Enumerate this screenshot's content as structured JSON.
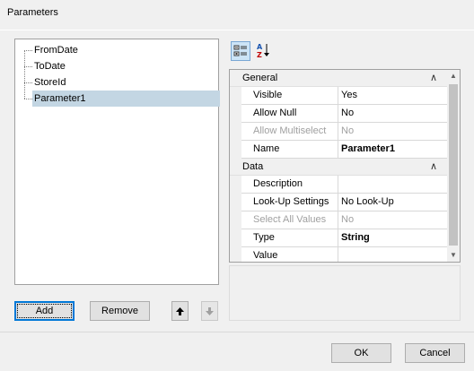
{
  "window": {
    "title": "Parameters"
  },
  "tree": {
    "items": [
      {
        "label": "FromDate",
        "selected": false
      },
      {
        "label": "ToDate",
        "selected": false
      },
      {
        "label": "StoreId",
        "selected": false
      },
      {
        "label": "Parameter1",
        "selected": true
      }
    ]
  },
  "buttons": {
    "add": "Add",
    "remove": "Remove",
    "move_up_icon": "arrow-up-icon",
    "move_down_icon": "arrow-down-icon",
    "ok": "OK",
    "cancel": "Cancel"
  },
  "toolbar": {
    "categorized_icon": "categorized-icon",
    "alphabetical_icon": "sort-az-icon"
  },
  "property_grid": {
    "categories": [
      {
        "name": "General",
        "props": [
          {
            "name": "Visible",
            "value": "Yes",
            "disabled": false,
            "bold": false
          },
          {
            "name": "Allow Null",
            "value": "No",
            "disabled": false,
            "bold": false
          },
          {
            "name": "Allow Multiselect",
            "value": "No",
            "disabled": true,
            "bold": false
          },
          {
            "name": "Name",
            "value": "Parameter1",
            "disabled": false,
            "bold": true
          }
        ]
      },
      {
        "name": "Data",
        "props": [
          {
            "name": "Description",
            "value": "",
            "disabled": false,
            "bold": false
          },
          {
            "name": "Look-Up Settings",
            "value": "No Look-Up",
            "disabled": false,
            "bold": false
          },
          {
            "name": "Select All Values",
            "value": "No",
            "disabled": true,
            "bold": false
          },
          {
            "name": "Type",
            "value": "String",
            "disabled": false,
            "bold": true
          },
          {
            "name": "Value",
            "value": "",
            "disabled": false,
            "bold": false
          }
        ]
      }
    ]
  },
  "colors": {
    "selection": "#c3d6e3",
    "default_button_border": "#0078d7"
  }
}
